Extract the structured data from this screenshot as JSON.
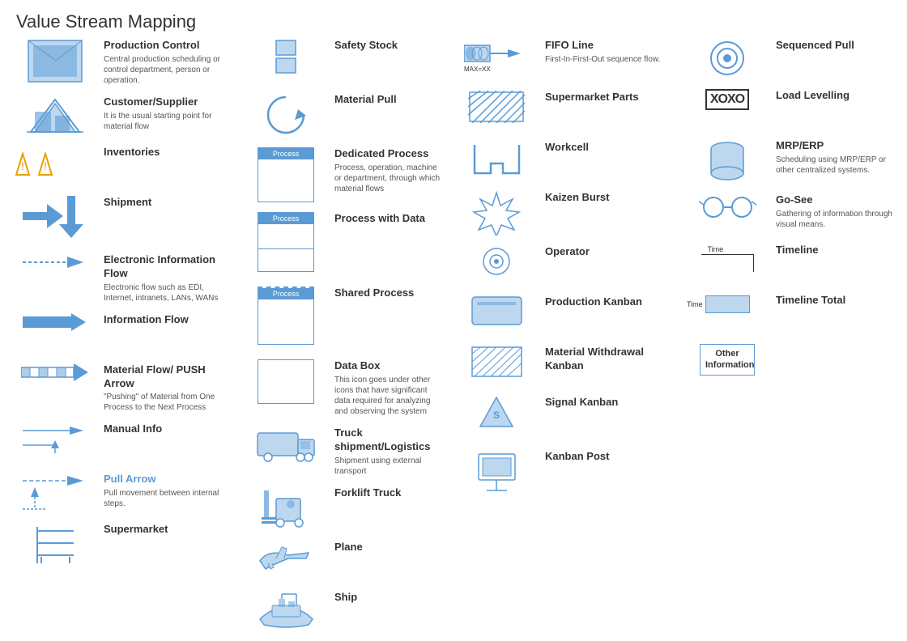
{
  "title": "Value Stream Mapping",
  "columns": [
    {
      "id": "col1",
      "items": [
        {
          "id": "production-control",
          "title": "Production Control",
          "desc": "Central production scheduling or control department, person or operation.",
          "icon": "production-control"
        },
        {
          "id": "customer-supplier",
          "title": "Customer/Supplier",
          "desc": "It is the usual starting point for material flow",
          "icon": "customer-supplier"
        },
        {
          "id": "inventories",
          "title": "Inventories",
          "desc": "",
          "icon": "inventories"
        },
        {
          "id": "shipment",
          "title": "Shipment",
          "desc": "",
          "icon": "shipment"
        },
        {
          "id": "electronic-info-flow",
          "title": "Electronic Information Flow",
          "desc": "Electronic flow such as EDI, Internet, intranets, LANs, WANs",
          "icon": "electronic-info-flow"
        },
        {
          "id": "information-flow",
          "title": "Information Flow",
          "desc": "",
          "icon": "information-flow"
        },
        {
          "id": "material-flow-push",
          "title": "Material Flow/ PUSH Arrow",
          "desc": "\"Pushing\" of Material from One Process to the Next Process",
          "icon": "material-flow-push"
        },
        {
          "id": "manual-info",
          "title": "Manual Info",
          "desc": "",
          "icon": "manual-info"
        },
        {
          "id": "pull-arrow",
          "title": "Pull Arrow",
          "desc": "Pull movement between internal steps.",
          "icon": "pull-arrow"
        },
        {
          "id": "supermarket",
          "title": "Supermarket",
          "desc": "",
          "icon": "supermarket"
        }
      ]
    },
    {
      "id": "col2",
      "items": [
        {
          "id": "safety-stock",
          "title": "Safety Stock",
          "desc": "",
          "icon": "safety-stock"
        },
        {
          "id": "material-pull",
          "title": "Material Pull",
          "desc": "",
          "icon": "material-pull"
        },
        {
          "id": "dedicated-process",
          "title": "Dedicated Process",
          "desc": "Process, operation, machine or department, through which material flows",
          "icon": "dedicated-process"
        },
        {
          "id": "process-with-data",
          "title": "Process with Data",
          "desc": "",
          "icon": "process-with-data"
        },
        {
          "id": "shared-process",
          "title": "Shared Process",
          "desc": "",
          "icon": "shared-process"
        },
        {
          "id": "data-box",
          "title": "Data Box",
          "desc": "This icon goes under other icons that have significant data required for analyzing and observing the system",
          "icon": "data-box"
        },
        {
          "id": "truck-shipment",
          "title": "Truck shipment/Logistics",
          "desc": "Shipment using external transport",
          "icon": "truck-shipment"
        },
        {
          "id": "forklift-truck",
          "title": "Forklift Truck",
          "desc": "",
          "icon": "forklift-truck"
        },
        {
          "id": "plane",
          "title": "Plane",
          "desc": "",
          "icon": "plane"
        },
        {
          "id": "ship",
          "title": "Ship",
          "desc": "",
          "icon": "ship"
        }
      ]
    },
    {
      "id": "col3",
      "items": [
        {
          "id": "fifo-line",
          "title": "FIFO Line",
          "desc": "First-In-First-Out sequence flow.",
          "icon": "fifo-line"
        },
        {
          "id": "supermarket-parts",
          "title": "Supermarket Parts",
          "desc": "",
          "icon": "supermarket-parts"
        },
        {
          "id": "workcell",
          "title": "Workcell",
          "desc": "",
          "icon": "workcell"
        },
        {
          "id": "kaizen-burst",
          "title": "Kaizen Burst",
          "desc": "",
          "icon": "kaizen-burst"
        },
        {
          "id": "operator",
          "title": "Operator",
          "desc": "",
          "icon": "operator"
        },
        {
          "id": "production-kanban",
          "title": "Production Kanban",
          "desc": "",
          "icon": "production-kanban"
        },
        {
          "id": "material-withdrawal-kanban",
          "title": "Material Withdrawal Kanban",
          "desc": "",
          "icon": "material-withdrawal-kanban"
        },
        {
          "id": "signal-kanban",
          "title": "Signal Kanban",
          "desc": "",
          "icon": "signal-kanban"
        },
        {
          "id": "kanban-post",
          "title": "Kanban Post",
          "desc": "",
          "icon": "kanban-post"
        }
      ]
    },
    {
      "id": "col4",
      "items": [
        {
          "id": "sequenced-pull",
          "title": "Sequenced Pull",
          "desc": "",
          "icon": "sequenced-pull"
        },
        {
          "id": "load-levelling",
          "title": "Load Levelling",
          "desc": "",
          "icon": "load-levelling"
        },
        {
          "id": "mrp-erp",
          "title": "MRP/ERP",
          "desc": "Scheduling using MRP/ERP or other centralized systems.",
          "icon": "mrp-erp"
        },
        {
          "id": "go-see",
          "title": "Go-See",
          "desc": "Gathering of information through visual means.",
          "icon": "go-see"
        },
        {
          "id": "timeline",
          "title": "Timeline",
          "desc": "",
          "icon": "timeline"
        },
        {
          "id": "timeline-total",
          "title": "Timeline Total",
          "desc": "",
          "icon": "timeline-total"
        },
        {
          "id": "other-information",
          "title": "Other Information",
          "desc": "",
          "icon": "other-information"
        }
      ]
    }
  ]
}
